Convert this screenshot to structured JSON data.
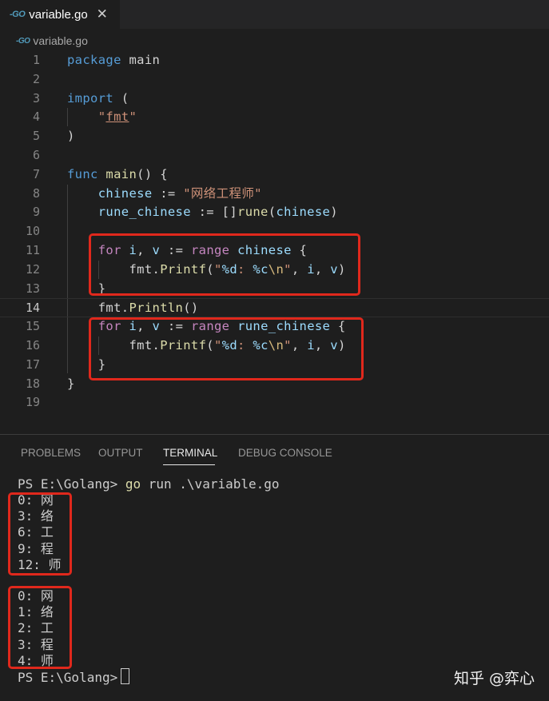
{
  "tab": {
    "icon": "go-file-icon",
    "logo_text": "-GO",
    "label": "variable.go",
    "close_symbol": "✕"
  },
  "breadcrumb": {
    "icon": "go-file-icon",
    "logo_text": "-GO",
    "label": "variable.go"
  },
  "editor": {
    "current_line": 14,
    "lines": [
      {
        "n": "1",
        "tokens": [
          [
            "kw",
            "package"
          ],
          [
            "pkg",
            " main"
          ]
        ]
      },
      {
        "n": "2",
        "tokens": []
      },
      {
        "n": "3",
        "tokens": [
          [
            "kw",
            "import"
          ],
          [
            "pkg",
            " ("
          ]
        ]
      },
      {
        "n": "4",
        "tokens": [
          [
            "pkg",
            "    "
          ],
          [
            "str",
            "\""
          ],
          [
            "str fmt-underline",
            "fmt"
          ],
          [
            "str",
            "\""
          ]
        ]
      },
      {
        "n": "5",
        "tokens": [
          [
            "pkg",
            ")"
          ]
        ]
      },
      {
        "n": "6",
        "tokens": []
      },
      {
        "n": "7",
        "tokens": [
          [
            "kw",
            "func"
          ],
          [
            "pkg",
            " "
          ],
          [
            "fn",
            "main"
          ],
          [
            "pkg",
            "() {"
          ]
        ]
      },
      {
        "n": "8",
        "tokens": [
          [
            "pkg",
            "    "
          ],
          [
            "var",
            "chinese"
          ],
          [
            "pkg",
            " := "
          ],
          [
            "str",
            "\"网络工程师\""
          ]
        ]
      },
      {
        "n": "9",
        "tokens": [
          [
            "pkg",
            "    "
          ],
          [
            "var",
            "rune_chinese"
          ],
          [
            "pkg",
            " := []"
          ],
          [
            "fn",
            "rune"
          ],
          [
            "pkg",
            "("
          ],
          [
            "var",
            "chinese"
          ],
          [
            "pkg",
            ")"
          ]
        ]
      },
      {
        "n": "10",
        "tokens": []
      },
      {
        "n": "11",
        "tokens": [
          [
            "pkg",
            "    "
          ],
          [
            "kw2",
            "for"
          ],
          [
            "pkg",
            " "
          ],
          [
            "var",
            "i"
          ],
          [
            "pkg",
            ", "
          ],
          [
            "var",
            "v"
          ],
          [
            "pkg",
            " := "
          ],
          [
            "kw2",
            "range"
          ],
          [
            "pkg",
            " "
          ],
          [
            "var",
            "chinese"
          ],
          [
            "pkg",
            " {"
          ]
        ]
      },
      {
        "n": "12",
        "tokens": [
          [
            "pkg",
            "        fmt."
          ],
          [
            "fn",
            "Printf"
          ],
          [
            "pkg",
            "("
          ],
          [
            "str",
            "\""
          ],
          [
            "fmt",
            "%d"
          ],
          [
            "str",
            ": "
          ],
          [
            "fmt",
            "%c"
          ],
          [
            "esc",
            "\\n"
          ],
          [
            "str",
            "\""
          ],
          [
            "pkg",
            ", "
          ],
          [
            "var",
            "i"
          ],
          [
            "pkg",
            ", "
          ],
          [
            "var",
            "v"
          ],
          [
            "pkg",
            ")"
          ]
        ]
      },
      {
        "n": "13",
        "tokens": [
          [
            "pkg",
            "    }"
          ]
        ]
      },
      {
        "n": "14",
        "tokens": [
          [
            "pkg",
            "    fmt."
          ],
          [
            "fn",
            "Println"
          ],
          [
            "pkg",
            "()"
          ]
        ]
      },
      {
        "n": "15",
        "tokens": [
          [
            "pkg",
            "    "
          ],
          [
            "kw2",
            "for"
          ],
          [
            "pkg",
            " "
          ],
          [
            "var",
            "i"
          ],
          [
            "pkg",
            ", "
          ],
          [
            "var",
            "v"
          ],
          [
            "pkg",
            " := "
          ],
          [
            "kw2",
            "range"
          ],
          [
            "pkg",
            " "
          ],
          [
            "var",
            "rune_chinese"
          ],
          [
            "pkg",
            " {"
          ]
        ]
      },
      {
        "n": "16",
        "tokens": [
          [
            "pkg",
            "        fmt."
          ],
          [
            "fn",
            "Printf"
          ],
          [
            "pkg",
            "("
          ],
          [
            "str",
            "\""
          ],
          [
            "fmt",
            "%d"
          ],
          [
            "str",
            ": "
          ],
          [
            "fmt",
            "%c"
          ],
          [
            "esc",
            "\\n"
          ],
          [
            "str",
            "\""
          ],
          [
            "pkg",
            ", "
          ],
          [
            "var",
            "i"
          ],
          [
            "pkg",
            ", "
          ],
          [
            "var",
            "v"
          ],
          [
            "pkg",
            ")"
          ]
        ]
      },
      {
        "n": "17",
        "tokens": [
          [
            "pkg",
            "    }"
          ]
        ]
      },
      {
        "n": "18",
        "tokens": [
          [
            "pkg",
            "}"
          ]
        ]
      },
      {
        "n": "19",
        "tokens": []
      }
    ]
  },
  "panel": {
    "tabs": [
      {
        "label": "PROBLEMS",
        "active": false
      },
      {
        "label": "OUTPUT",
        "active": false
      },
      {
        "label": "TERMINAL",
        "active": true
      },
      {
        "label": "DEBUG CONSOLE",
        "active": false
      }
    ]
  },
  "terminal": {
    "prompt": "PS E:\\Golang> ",
    "command_word": "go",
    "command_rest": " run .\\variable.go",
    "output_bytes": [
      "0: 网",
      "3: 络",
      "6: 工",
      "9: 程",
      "12: 师"
    ],
    "output_runes": [
      "0: 网",
      "1: 络",
      "2: 工",
      "3: 程",
      "4: 师"
    ],
    "final_prompt": "PS E:\\Golang>"
  },
  "watermark": "知乎 @弈心",
  "colors": {
    "highlight_box": "#e0281c",
    "editor_bg": "#1e1e1e",
    "keyword": "#569cd6",
    "control": "#c586c0",
    "string": "#ce9178",
    "function": "#dcdcaa"
  }
}
